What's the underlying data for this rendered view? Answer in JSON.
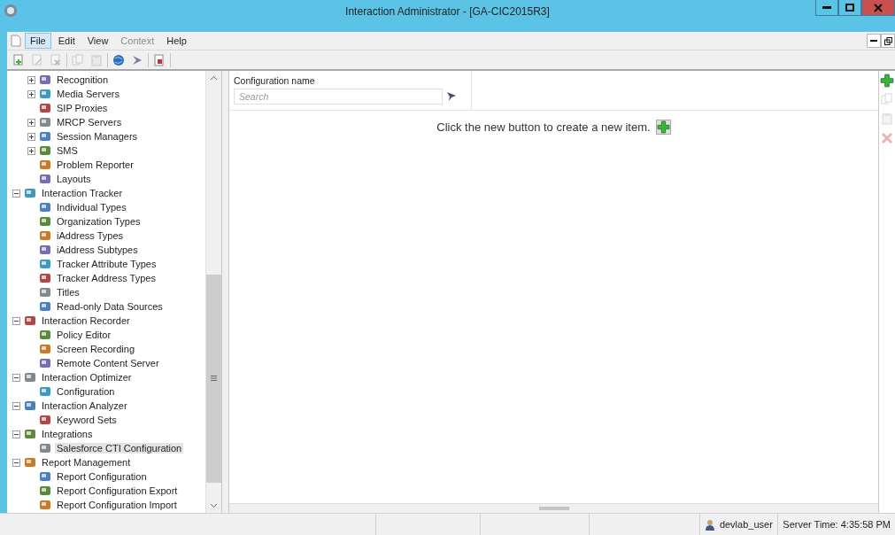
{
  "window": {
    "title": "Interaction Administrator - [GA-CIC2015R3]"
  },
  "menu": [
    {
      "label": "File",
      "selected": true,
      "disabled": false
    },
    {
      "label": "Edit",
      "selected": false,
      "disabled": false
    },
    {
      "label": "View",
      "selected": false,
      "disabled": false
    },
    {
      "label": "Context",
      "selected": false,
      "disabled": true
    },
    {
      "label": "Help",
      "selected": false,
      "disabled": false
    }
  ],
  "toolbar": [
    {
      "kind": "new",
      "disabled": false
    },
    {
      "kind": "edit",
      "disabled": true
    },
    {
      "kind": "delete",
      "disabled": true
    },
    {
      "kind": "copy",
      "disabled": true
    },
    {
      "kind": "paste",
      "disabled": true
    },
    {
      "kind": "globe",
      "disabled": false
    },
    {
      "kind": "filter",
      "disabled": false
    },
    {
      "kind": "report",
      "disabled": false
    }
  ],
  "tree": {
    "scrolled_items": [
      {
        "label": "Recognition",
        "expandable": true,
        "expanded": false,
        "selected": false
      },
      {
        "label": "Media Servers",
        "expandable": true,
        "expanded": false,
        "selected": false
      },
      {
        "label": "SIP Proxies",
        "expandable": false,
        "selected": false
      },
      {
        "label": "MRCP Servers",
        "expandable": true,
        "expanded": false,
        "selected": false
      },
      {
        "label": "Session Managers",
        "expandable": true,
        "expanded": false,
        "selected": false
      },
      {
        "label": "SMS",
        "expandable": true,
        "expanded": false,
        "selected": false
      },
      {
        "label": "Problem Reporter",
        "expandable": false,
        "selected": false
      },
      {
        "label": "Layouts",
        "expandable": false,
        "selected": false
      }
    ],
    "items": [
      {
        "label": "Interaction Tracker",
        "expandable": true,
        "expanded": true,
        "selected": false,
        "children": [
          {
            "label": "Individual Types",
            "selected": false
          },
          {
            "label": "Organization Types",
            "selected": false
          },
          {
            "label": "iAddress Types",
            "selected": false
          },
          {
            "label": "iAddress Subtypes",
            "selected": false
          },
          {
            "label": "Tracker Attribute Types",
            "selected": false
          },
          {
            "label": "Tracker Address Types",
            "selected": false
          },
          {
            "label": "Titles",
            "selected": false
          },
          {
            "label": "Read-only Data Sources",
            "selected": false
          }
        ]
      },
      {
        "label": "Interaction Recorder",
        "expandable": true,
        "expanded": true,
        "selected": false,
        "children": [
          {
            "label": "Policy Editor",
            "selected": false
          },
          {
            "label": "Screen Recording",
            "selected": false
          },
          {
            "label": "Remote Content Server",
            "selected": false
          }
        ]
      },
      {
        "label": "Interaction Optimizer",
        "expandable": true,
        "expanded": true,
        "selected": false,
        "children": [
          {
            "label": "Configuration",
            "selected": false
          }
        ]
      },
      {
        "label": "Interaction Analyzer",
        "expandable": true,
        "expanded": true,
        "selected": false,
        "children": [
          {
            "label": "Keyword Sets",
            "selected": false
          }
        ]
      },
      {
        "label": "Integrations",
        "expandable": true,
        "expanded": true,
        "selected": false,
        "children": [
          {
            "label": "Salesforce CTI Configuration",
            "selected": true
          }
        ]
      },
      {
        "label": "Report Management",
        "expandable": true,
        "expanded": true,
        "selected": false,
        "children": [
          {
            "label": "Report Configuration",
            "selected": false
          },
          {
            "label": "Report Configuration Export",
            "selected": false
          },
          {
            "label": "Report Configuration Import",
            "selected": false
          }
        ]
      }
    ]
  },
  "list": {
    "column": "Configuration name",
    "search": {
      "placeholder": "Search"
    },
    "message": "Click the new button to create a new item."
  },
  "actions": [
    {
      "kind": "add",
      "disabled": false
    },
    {
      "kind": "copy",
      "disabled": true
    },
    {
      "kind": "paste",
      "disabled": true
    },
    {
      "kind": "delete",
      "disabled": true
    }
  ],
  "status_bar": {
    "user": "devlab_user",
    "server_time": "Server Time: 4:35:58 PM"
  }
}
